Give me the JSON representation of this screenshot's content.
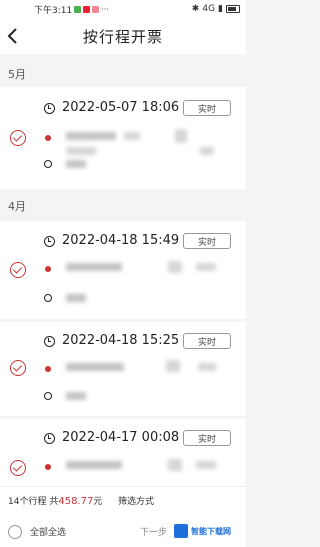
{
  "status_bar": {
    "time": "下午3:11",
    "network": "4G",
    "battery": "96"
  },
  "header": {
    "title": "按行程开票"
  },
  "months": [
    "5月",
    "4月"
  ],
  "trips": [
    {
      "datetime": "2022-05-07 18:06",
      "tag": "实时"
    },
    {
      "datetime": "2022-04-18 15:49",
      "tag": "实时"
    },
    {
      "datetime": "2022-04-18 15:25",
      "tag": "实时"
    },
    {
      "datetime": "2022-04-17 00:08",
      "tag": "实时"
    }
  ],
  "footer": {
    "count_text": "14个行程",
    "amount_prefix": "共",
    "amount": "458.77",
    "amount_suffix": "元",
    "filter_label": "筛选方式",
    "select_all_label": "全部全选",
    "next_label": "下一步"
  },
  "watermark": {
    "text": "智能下载网"
  },
  "colors": {
    "accent": "#cc3333",
    "background": "#f4f4f4"
  }
}
